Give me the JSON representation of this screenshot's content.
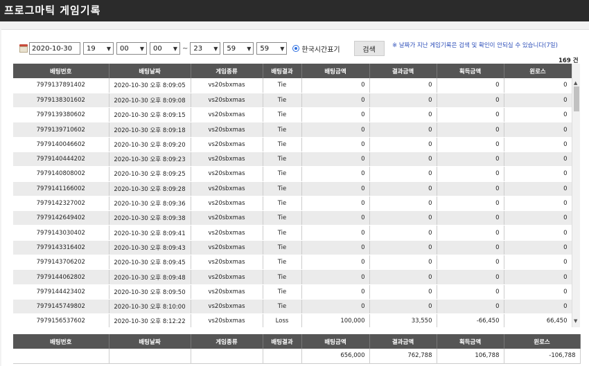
{
  "window": {
    "title": "프로그마틱 게임기록"
  },
  "filters": {
    "date_value": "2020-10-30",
    "start_hour": "19",
    "start_min": "00",
    "start_sec": "00",
    "tilde": "~",
    "end_hour": "23",
    "end_min": "59",
    "end_sec": "59",
    "timezone_label": "한국시간표기",
    "search_label": "검색",
    "notice": "※ 날짜가 지난 게임기록은 검색 및 확인이 안되실 수 있습니다(7일)"
  },
  "count_text": "169 건",
  "columns": [
    "배팅번호",
    "배팅날짜",
    "게임종류",
    "배팅결과",
    "배팅금액",
    "결과금액",
    "획득금액",
    "윈로스"
  ],
  "rows": [
    [
      "7979137891402",
      "2020-10-30 오후 8:09:05",
      "vs20sbxmas",
      "Tie",
      "0",
      "0",
      "0",
      "0"
    ],
    [
      "7979138301602",
      "2020-10-30 오후 8:09:08",
      "vs20sbxmas",
      "Tie",
      "0",
      "0",
      "0",
      "0"
    ],
    [
      "7979139380602",
      "2020-10-30 오후 8:09:15",
      "vs20sbxmas",
      "Tie",
      "0",
      "0",
      "0",
      "0"
    ],
    [
      "7979139710602",
      "2020-10-30 오후 8:09:18",
      "vs20sbxmas",
      "Tie",
      "0",
      "0",
      "0",
      "0"
    ],
    [
      "7979140046602",
      "2020-10-30 오후 8:09:20",
      "vs20sbxmas",
      "Tie",
      "0",
      "0",
      "0",
      "0"
    ],
    [
      "7979140444202",
      "2020-10-30 오후 8:09:23",
      "vs20sbxmas",
      "Tie",
      "0",
      "0",
      "0",
      "0"
    ],
    [
      "7979140808002",
      "2020-10-30 오후 8:09:25",
      "vs20sbxmas",
      "Tie",
      "0",
      "0",
      "0",
      "0"
    ],
    [
      "7979141166002",
      "2020-10-30 오후 8:09:28",
      "vs20sbxmas",
      "Tie",
      "0",
      "0",
      "0",
      "0"
    ],
    [
      "7979142327002",
      "2020-10-30 오후 8:09:36",
      "vs20sbxmas",
      "Tie",
      "0",
      "0",
      "0",
      "0"
    ],
    [
      "7979142649402",
      "2020-10-30 오후 8:09:38",
      "vs20sbxmas",
      "Tie",
      "0",
      "0",
      "0",
      "0"
    ],
    [
      "7979143030402",
      "2020-10-30 오후 8:09:41",
      "vs20sbxmas",
      "Tie",
      "0",
      "0",
      "0",
      "0"
    ],
    [
      "7979143316402",
      "2020-10-30 오후 8:09:43",
      "vs20sbxmas",
      "Tie",
      "0",
      "0",
      "0",
      "0"
    ],
    [
      "7979143706202",
      "2020-10-30 오후 8:09:45",
      "vs20sbxmas",
      "Tie",
      "0",
      "0",
      "0",
      "0"
    ],
    [
      "7979144062802",
      "2020-10-30 오후 8:09:48",
      "vs20sbxmas",
      "Tie",
      "0",
      "0",
      "0",
      "0"
    ],
    [
      "7979144423402",
      "2020-10-30 오후 8:09:50",
      "vs20sbxmas",
      "Tie",
      "0",
      "0",
      "0",
      "0"
    ],
    [
      "7979145749802",
      "2020-10-30 오후 8:10:00",
      "vs20sbxmas",
      "Tie",
      "0",
      "0",
      "0",
      "0"
    ],
    [
      "7979156537602",
      "2020-10-30 오후 8:12:22",
      "vs20sbxmas",
      "Loss",
      "100,000",
      "33,550",
      "-66,450",
      "66,450"
    ]
  ],
  "summary": {
    "columns": [
      "배팅번호",
      "배팅날짜",
      "게임종류",
      "배팅결과",
      "배팅금액",
      "결과금액",
      "획득금액",
      "윈로스"
    ],
    "values": [
      "",
      "",
      "",
      "",
      "656,000",
      "762,788",
      "106,788",
      "-106,788"
    ]
  },
  "icons": {
    "calendar": "calendar-icon",
    "chevron": "chevron-down-icon"
  }
}
